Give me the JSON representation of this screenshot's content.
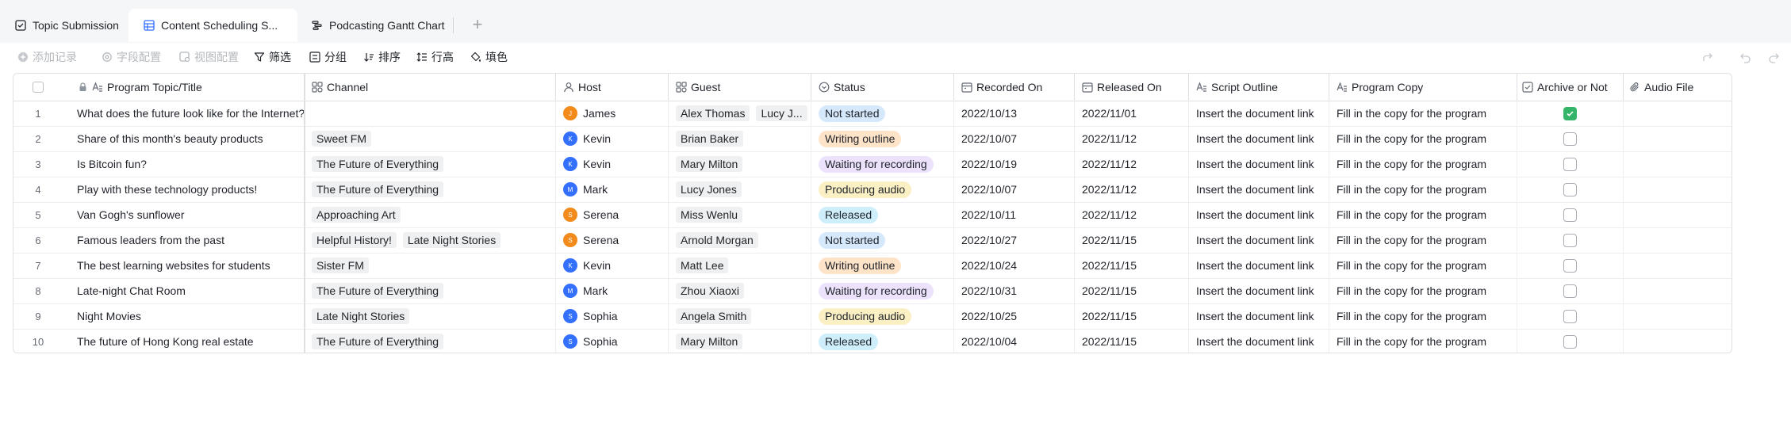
{
  "tabs": [
    {
      "label": "Topic Submission",
      "icon": "form-icon"
    },
    {
      "label": "Content Scheduling S...",
      "icon": "grid-table-icon"
    },
    {
      "label": "Podcasting Gantt Chart",
      "icon": "gantt-icon"
    }
  ],
  "toolbar": {
    "add_record": "添加记录",
    "field_config": "字段配置",
    "view_config": "视图配置",
    "filter": "筛选",
    "group": "分组",
    "sort": "排序",
    "row_height": "行高",
    "fill_color": "填色"
  },
  "columns": {
    "topic": "Program Topic/Title",
    "channel": "Channel",
    "host": "Host",
    "guest": "Guest",
    "status": "Status",
    "recorded": "Recorded On",
    "released": "Released On",
    "script": "Script Outline",
    "copy": "Program Copy",
    "archive": "Archive or Not",
    "audio": "Audio File"
  },
  "colors": {
    "avatar_orange": "#f28b1c",
    "avatar_blue": "#3370ff",
    "check_green": "#34b56a",
    "status_not_started": "#d6e8fb",
    "status_writing": "#fde3c8",
    "status_waiting": "#ece2fb",
    "status_producing": "#fbefc4",
    "status_released": "#cdeefa"
  },
  "rows": [
    {
      "num": "1",
      "topic": "What does the future look like for the Internet?",
      "channels": [],
      "host": "James",
      "host_initial": "J",
      "host_color": "#f28b1c",
      "guests": [
        "Alex Thomas",
        "Lucy J..."
      ],
      "status": "Not started",
      "status_color": "#d6e8fb",
      "recorded": "2022/10/13",
      "released": "2022/11/01",
      "script": "Insert the document link",
      "copy": "Fill in the copy for the program",
      "archived": true
    },
    {
      "num": "2",
      "topic": "Share of this month's beauty products",
      "channels": [
        "Sweet FM"
      ],
      "host": "Kevin",
      "host_initial": "K",
      "host_color": "#3370ff",
      "guests": [
        "Brian Baker"
      ],
      "status": "Writing outline",
      "status_color": "#fde3c8",
      "recorded": "2022/10/07",
      "released": "2022/11/12",
      "script": "Insert the document link",
      "copy": "Fill in the copy for the program",
      "archived": false
    },
    {
      "num": "3",
      "topic": "Is Bitcoin fun?",
      "channels": [
        "The Future of Everything"
      ],
      "host": "Kevin",
      "host_initial": "K",
      "host_color": "#3370ff",
      "guests": [
        "Mary Milton"
      ],
      "status": "Waiting for recording",
      "status_color": "#ece2fb",
      "recorded": "2022/10/19",
      "released": "2022/11/12",
      "script": "Insert the document link",
      "copy": "Fill in the copy for the program",
      "archived": false
    },
    {
      "num": "4",
      "topic": "Play with these technology products!",
      "channels": [
        "The Future of Everything"
      ],
      "host": "Mark",
      "host_initial": "M",
      "host_color": "#3370ff",
      "guests": [
        "Lucy Jones"
      ],
      "status": "Producing audio",
      "status_color": "#fbefc4",
      "recorded": "2022/10/07",
      "released": "2022/11/12",
      "script": "Insert the document link",
      "copy": "Fill in the copy for the program",
      "archived": false
    },
    {
      "num": "5",
      "topic": "Van Gogh's sunflower",
      "channels": [
        "Approaching Art"
      ],
      "host": "Serena",
      "host_initial": "S",
      "host_color": "#f28b1c",
      "guests": [
        "Miss Wenlu"
      ],
      "status": "Released",
      "status_color": "#cdeefa",
      "recorded": "2022/10/11",
      "released": "2022/11/12",
      "script": "Insert the document link",
      "copy": "Fill in the copy for the program",
      "archived": false
    },
    {
      "num": "6",
      "topic": "Famous leaders from the past",
      "channels": [
        "Helpful History!",
        "Late Night Stories"
      ],
      "host": "Serena",
      "host_initial": "S",
      "host_color": "#f28b1c",
      "guests": [
        "Arnold Morgan"
      ],
      "status": "Not started",
      "status_color": "#d6e8fb",
      "recorded": "2022/10/27",
      "released": "2022/11/15",
      "script": "Insert the document link",
      "copy": "Fill in the copy for the program",
      "archived": false
    },
    {
      "num": "7",
      "topic": "The best learning websites for students",
      "channels": [
        "Sister FM"
      ],
      "host": "Kevin",
      "host_initial": "K",
      "host_color": "#3370ff",
      "guests": [
        "Matt Lee"
      ],
      "status": "Writing outline",
      "status_color": "#fde3c8",
      "recorded": "2022/10/24",
      "released": "2022/11/15",
      "script": "Insert the document link",
      "copy": "Fill in the copy for the program",
      "archived": false
    },
    {
      "num": "8",
      "topic": "Late-night Chat Room",
      "channels": [
        "The Future of Everything"
      ],
      "host": "Mark",
      "host_initial": "M",
      "host_color": "#3370ff",
      "guests": [
        "Zhou Xiaoxi"
      ],
      "status": "Waiting for recording",
      "status_color": "#ece2fb",
      "recorded": "2022/10/31",
      "released": "2022/11/15",
      "script": "Insert the document link",
      "copy": "Fill in the copy for the program",
      "archived": false
    },
    {
      "num": "9",
      "topic": "Night Movies",
      "channels": [
        "Late Night Stories"
      ],
      "host": "Sophia",
      "host_initial": "S",
      "host_color": "#3370ff",
      "guests": [
        "Angela Smith"
      ],
      "status": "Producing audio",
      "status_color": "#fbefc4",
      "recorded": "2022/10/25",
      "released": "2022/11/15",
      "script": "Insert the document link",
      "copy": "Fill in the copy for the program",
      "archived": false
    },
    {
      "num": "10",
      "topic": "The future of Hong Kong real estate",
      "channels": [
        "The Future of Everything"
      ],
      "host": "Sophia",
      "host_initial": "S",
      "host_color": "#3370ff",
      "guests": [
        "Mary Milton"
      ],
      "status": "Released",
      "status_color": "#cdeefa",
      "recorded": "2022/10/04",
      "released": "2022/11/15",
      "script": "Insert the document link",
      "copy": "Fill in the copy for the program",
      "archived": false
    }
  ]
}
